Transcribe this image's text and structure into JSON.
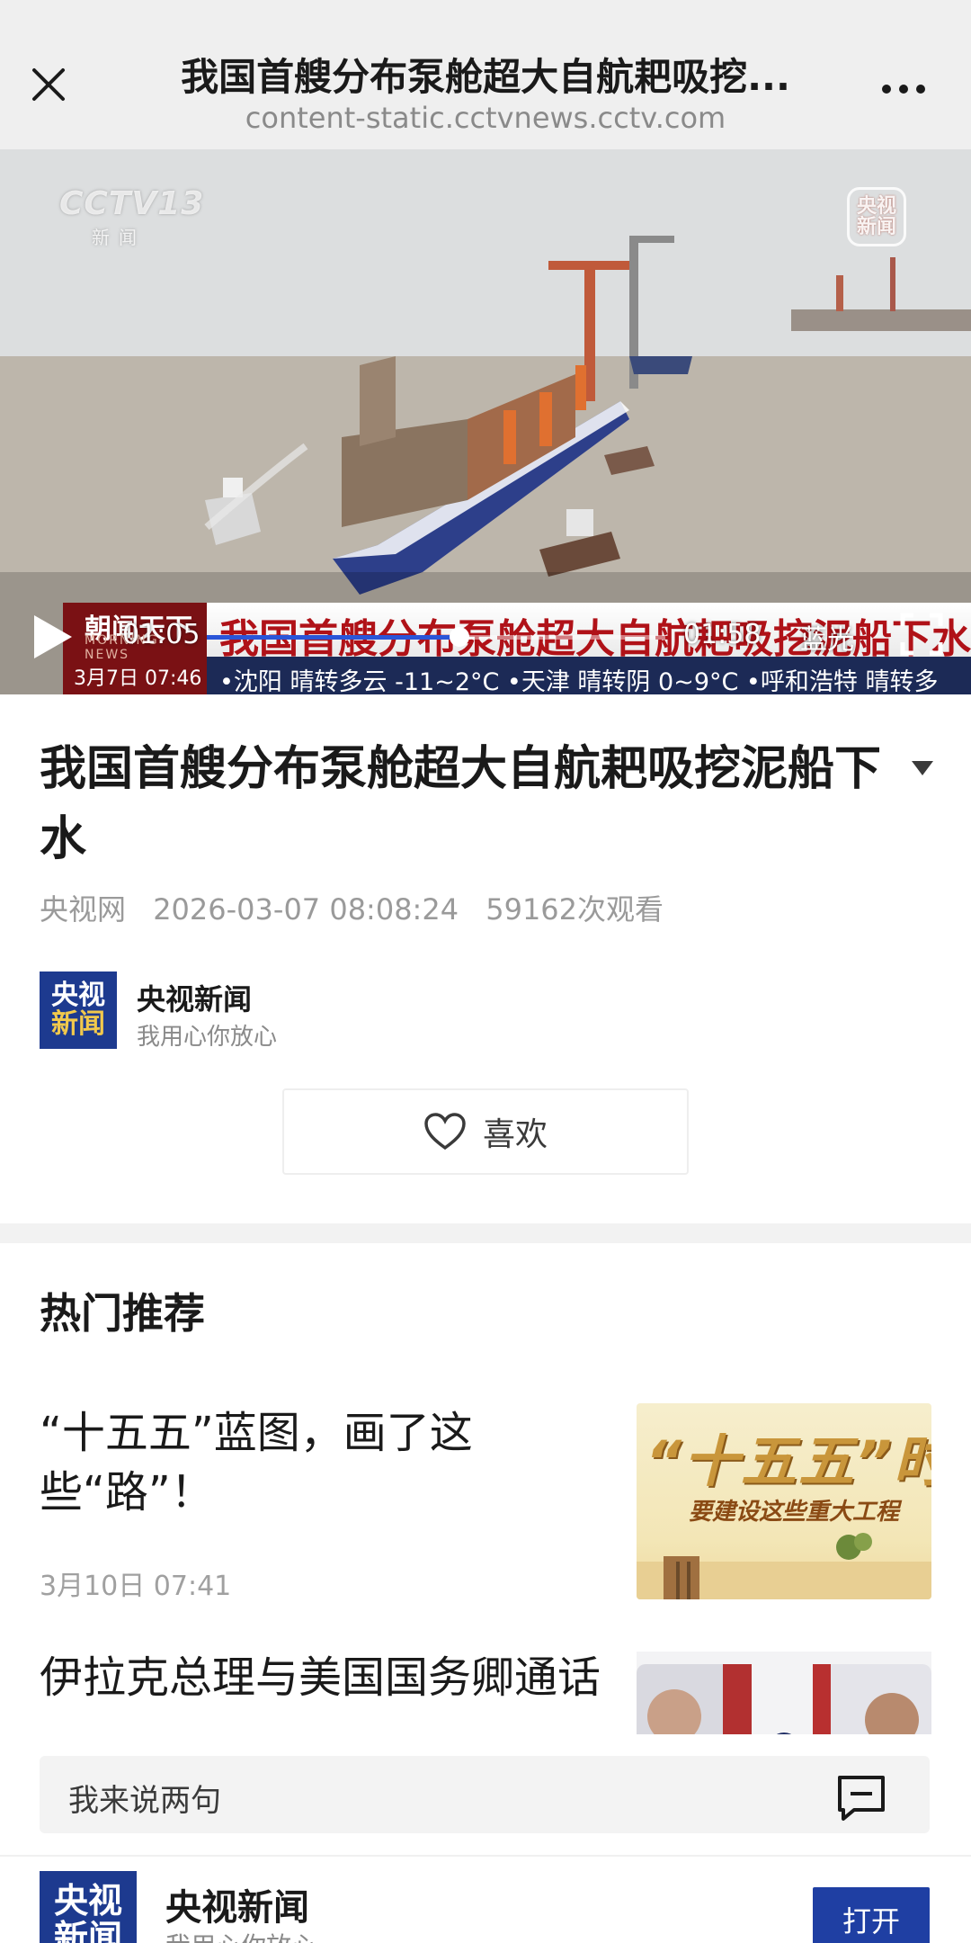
{
  "topbar": {
    "title": "我国首艘分布泵舱超大自航耙吸挖...",
    "url": "content-static.cctvnews.cctv.com"
  },
  "video": {
    "channel_logo": "CCTV13",
    "channel_logo_sub": "新闻",
    "corner_badge": [
      "央视",
      "新闻"
    ],
    "lower_third": {
      "program": "朝闻天下",
      "program_sub": "MORNING NEWS",
      "date": "3月7日 07:46",
      "headline": "我国首艘分布泵舱超大自航耙吸挖泥船下水",
      "weather": "•沈阳 晴转多云 -11~2°C   •天津 晴转阴 0~9°C   •呼和浩特 晴转多"
    },
    "current_time": "01:05",
    "total_time": "01:58",
    "progress": 0.55,
    "quality_label": "蓝光",
    "icons": {
      "play": "play-icon",
      "fullscreen": "fullscreen-icon"
    }
  },
  "article": {
    "title": "我国首艘分布泵舱超大自航耙吸挖泥船下水",
    "source": "央视网",
    "datetime": "2026-03-07 08:08:24",
    "views": "59162次观看"
  },
  "account": {
    "logo": [
      "央视",
      "新闻"
    ],
    "name": "央视新闻",
    "slogan": "我用心你放心"
  },
  "like": {
    "label": "喜欢"
  },
  "recommendations": {
    "heading": "热门推荐",
    "items": [
      {
        "title": "“十五五”蓝图，画了这些“路”！",
        "time": "3月10日 07:41",
        "thumb_text": "“十五五”时期",
        "thumb_sub": "要建设这些重大工程"
      },
      {
        "title": "伊拉克总理与美国国务卿通话"
      }
    ]
  },
  "comment": {
    "placeholder": "我来说两句"
  },
  "bottom_bar": {
    "logo": [
      "央视",
      "新闻"
    ],
    "name": "央视新闻",
    "slogan": "我用心你放心",
    "open_label": "打开"
  },
  "colors": {
    "brand_blue": "#1d3a8f",
    "open_button": "#1f3fa3",
    "progress": "#2a55d8",
    "headline_red": "#b01218"
  }
}
